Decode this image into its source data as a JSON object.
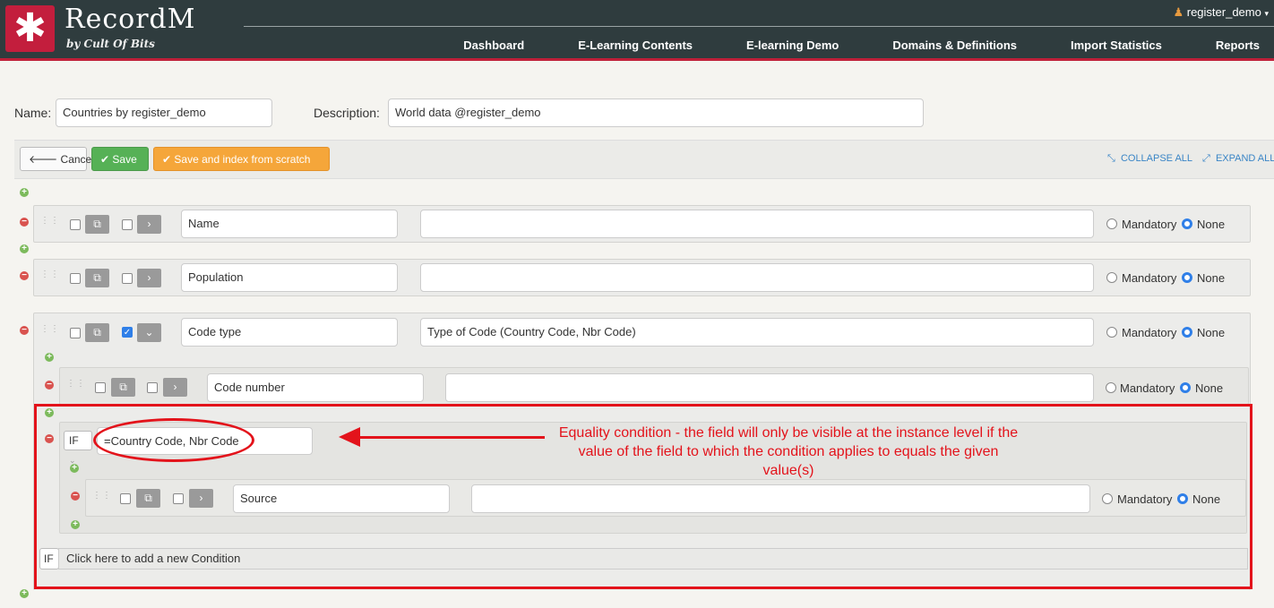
{
  "app": {
    "logo_glyph": "✱",
    "brand": "RecordM",
    "byline": "by Cult Of Bits",
    "user": "register_demo"
  },
  "nav": [
    "Dashboard",
    "E-Learning Contents",
    "E-learning Demo",
    "Domains & Definitions",
    "Import Statistics",
    "Reports"
  ],
  "form": {
    "name_label": "Name:",
    "name_value": "Countries by register_demo",
    "description_label": "Description:",
    "description_value": "World data @register_demo"
  },
  "toolbar": {
    "cancel": "Cancel",
    "save": "Save",
    "save_index": "Save and index from scratch",
    "collapse_all": "COLLAPSE ALL",
    "expand_all": "EXPAND ALL"
  },
  "fields": [
    {
      "name": "Name",
      "description": "",
      "mandatory": "Mandatory",
      "none": "None",
      "expanded": false
    },
    {
      "name": "Population",
      "description": "",
      "mandatory": "Mandatory",
      "none": "None",
      "expanded": false
    },
    {
      "name": "Code type",
      "description": "Type of Code (Country Code, Nbr Code)",
      "mandatory": "Mandatory",
      "none": "None",
      "expanded": true
    },
    {
      "name": "Code number",
      "description": "",
      "mandatory": "Mandatory",
      "none": "None",
      "expanded": false
    },
    {
      "name": "Source",
      "description": "",
      "mandatory": "Mandatory",
      "none": "None",
      "expanded": false
    }
  ],
  "condition": {
    "if_label": "IF",
    "value": "=Country Code, Nbr Code"
  },
  "new_condition": {
    "if_label": "IF",
    "text": "Click here to add a new Condition"
  },
  "annotation": {
    "text": "Equality condition - the field will only be visible at the instance level if the value of the field to which the condition applies to equals the given value(s)"
  },
  "colors": {
    "header": "#2f3c3e",
    "accent": "#c31e3d",
    "save": "#56b156",
    "save_index": "#f5a63a",
    "annotation": "#e3131b",
    "link": "#3a85c6"
  },
  "icons": [
    "asterisk-logo-icon",
    "user-icon",
    "caret-down-icon",
    "arrow-left-icon",
    "check-icon",
    "collapse-icon",
    "expand-icon",
    "plus-icon",
    "minus-icon",
    "drag-handle-icon",
    "duplicate-icon",
    "chevron-right-icon",
    "chevron-down-icon"
  ]
}
